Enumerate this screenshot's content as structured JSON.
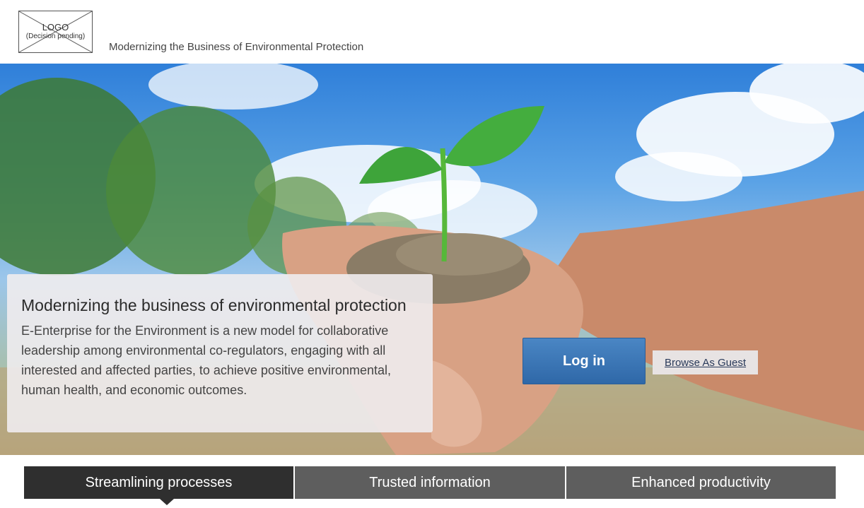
{
  "header": {
    "logo_line1": "LOGO",
    "logo_line2": "(Decision pending)",
    "tagline": "Modernizing the Business of Environmental Protection"
  },
  "hero": {
    "card_title": "Modernizing the business of environmental protection",
    "card_body": "E-Enterprise for the Environment is a new model for collaborative leadership among environmental co-regulators, engaging with all interested and affected parties, to achieve positive environmental, human health, and economic outcomes.",
    "login_label": "Log in",
    "guest_label": "Browse As Guest"
  },
  "tabs": [
    {
      "label": "Streamlining processes",
      "active": true
    },
    {
      "label": "Trusted information",
      "active": false
    },
    {
      "label": "Enhanced productivity",
      "active": false
    }
  ],
  "colors": {
    "login_button": "#3a76b8",
    "active_tab": "#2f2f2f",
    "inactive_tab": "#5e5e5e",
    "sky": "#2f7fd9"
  }
}
